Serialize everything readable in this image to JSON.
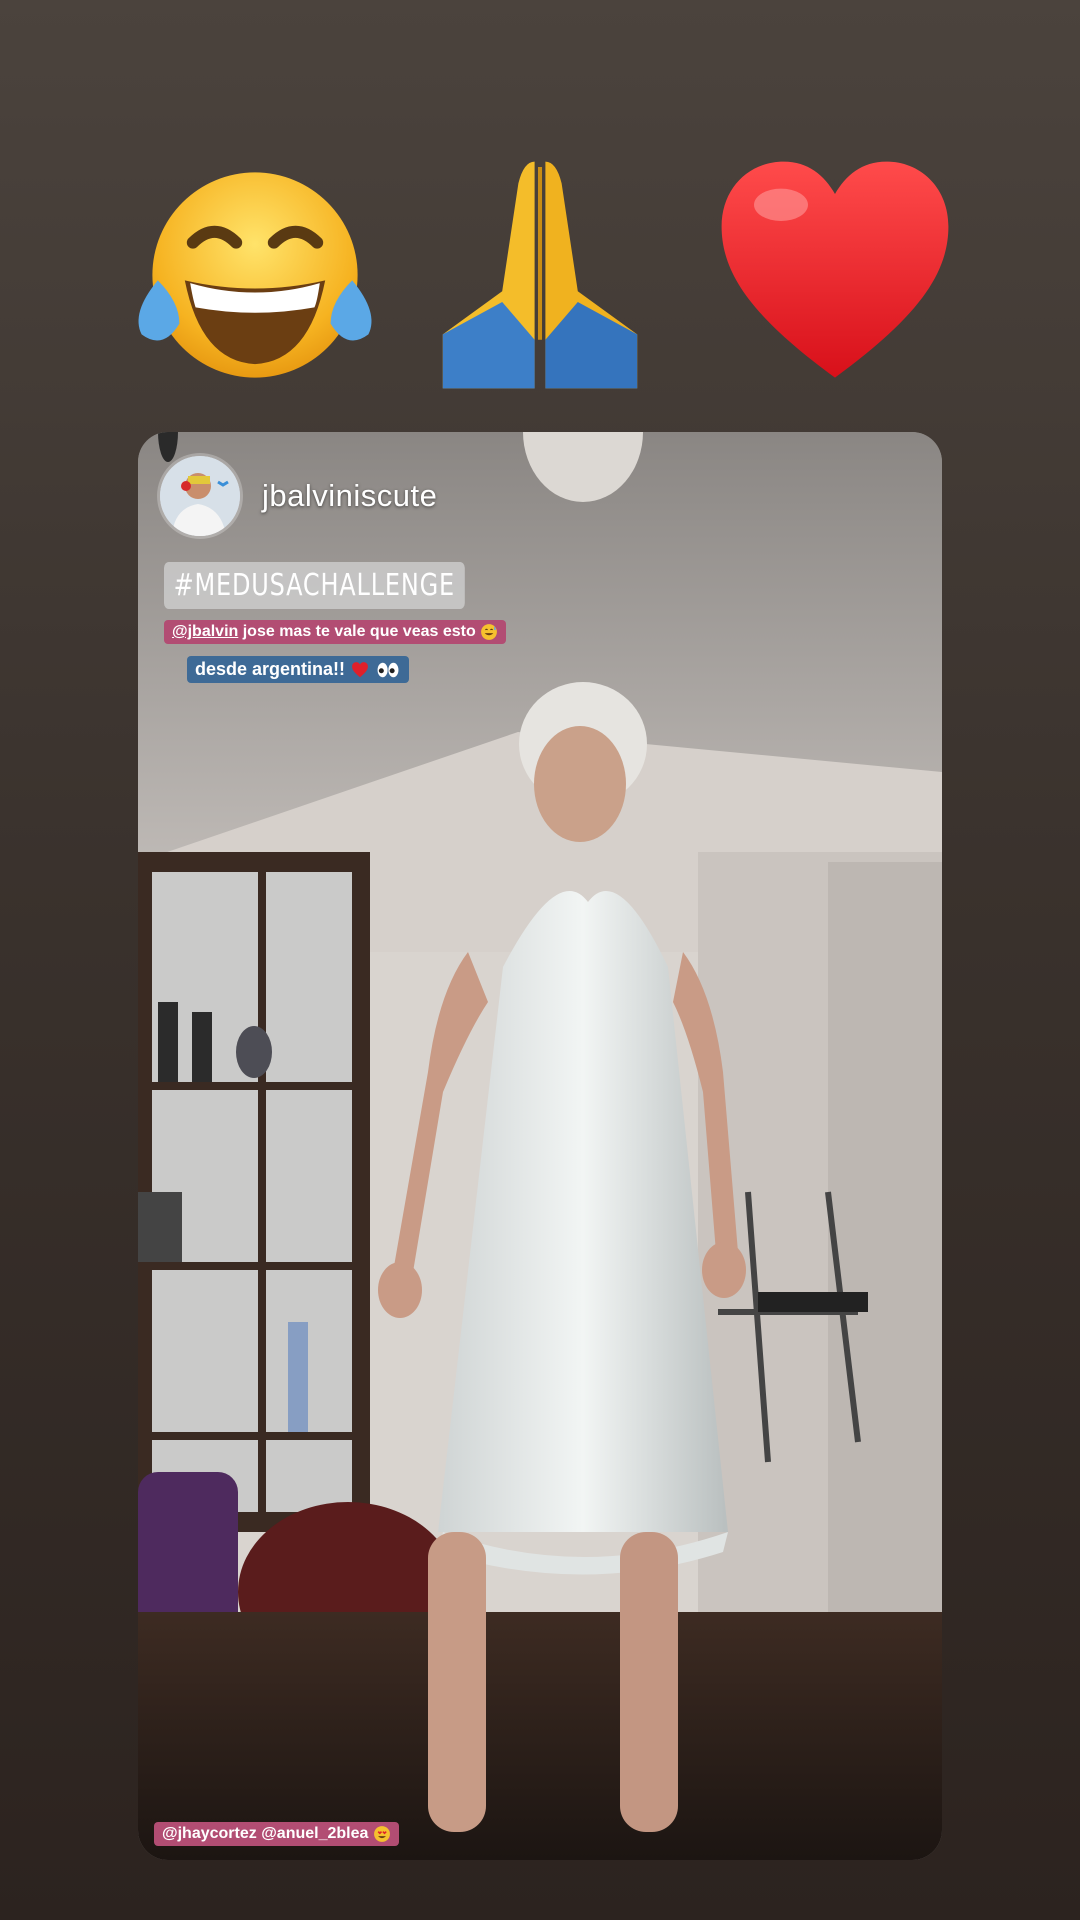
{
  "reactions": [
    {
      "name": "face-with-tears-of-joy-emoji"
    },
    {
      "name": "folded-hands-emoji"
    },
    {
      "name": "red-heart-emoji"
    }
  ],
  "post": {
    "username": "jbalviniscute",
    "hashtag": "#MEDUSACHALLENGE",
    "caption1": {
      "mention": "@jbalvin",
      "text": " jose mas te vale que veas esto"
    },
    "caption2": {
      "text": "desde argentina!! "
    },
    "caption3": {
      "mention1": "@jhaycortez",
      "mention2": " @anuel_2blea "
    }
  },
  "colors": {
    "mention_bg": "#b24d73",
    "caption_bg": "#3e6a96"
  }
}
